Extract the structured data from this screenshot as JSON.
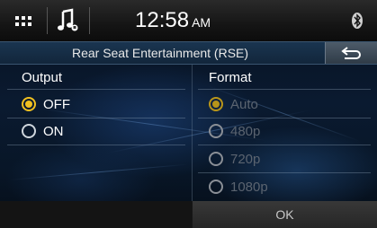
{
  "status_bar": {
    "clock_time": "12:58",
    "clock_ampm": "AM",
    "icons": [
      "grid-menu-icon",
      "music-note-icon",
      "bluetooth-icon"
    ]
  },
  "title_bar": {
    "title": "Rear Seat Entertainment (RSE)",
    "back_icon": "back-arrow-icon"
  },
  "output": {
    "header": "Output",
    "options": [
      {
        "label": "OFF",
        "selected": true,
        "enabled": true
      },
      {
        "label": "ON",
        "selected": false,
        "enabled": true
      }
    ]
  },
  "format": {
    "header": "Format",
    "options": [
      {
        "label": "Auto",
        "selected": true,
        "enabled": false
      },
      {
        "label": "480p",
        "selected": false,
        "enabled": false
      },
      {
        "label": "720p",
        "selected": false,
        "enabled": false
      },
      {
        "label": "1080p",
        "selected": false,
        "enabled": false
      }
    ]
  },
  "bottom_bar": {
    "ok_label": "OK"
  },
  "colors": {
    "accent_selected": "#f0c020",
    "title_bar": "#1a3550",
    "disabled_text": "#5b6470"
  }
}
